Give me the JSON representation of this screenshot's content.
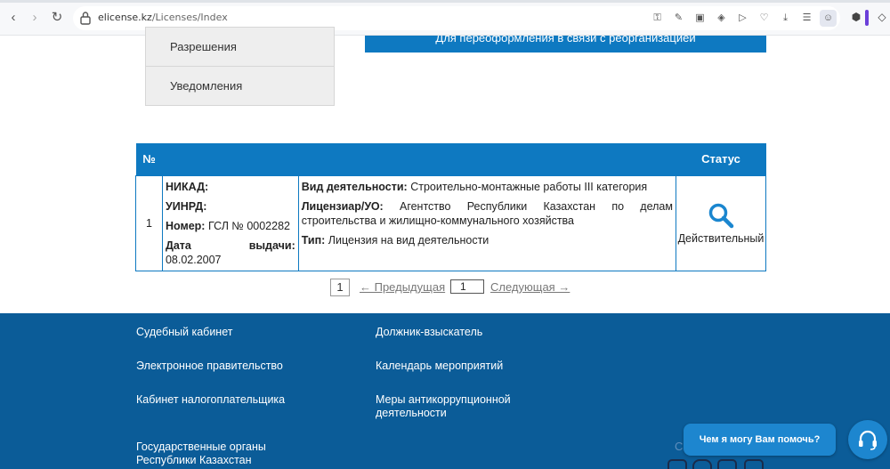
{
  "browser": {
    "url_domain": "elicense.kz",
    "url_path": "/Licenses/Index",
    "icons": [
      "key-icon",
      "edit-icon",
      "camera-icon",
      "shield-icon",
      "send-icon",
      "heart-icon",
      "download-icon",
      "playlist-icon",
      "profile-icon"
    ]
  },
  "sidebar": {
    "items": [
      {
        "label": "Разрешения"
      },
      {
        "label": "Уведомления"
      }
    ]
  },
  "reissue_button": {
    "label": "Для переоформления в связи с реорганизацией"
  },
  "table": {
    "headers": {
      "num": "№",
      "status": "Статус"
    },
    "row": {
      "num": "1",
      "nikad_label": "НИКАД:",
      "uinrd_label": "УИНРД:",
      "number_label": "Номер:",
      "number_value": "ГСЛ № 0002282",
      "date_label": "Дата выдачи:",
      "date_value": "08.02.2007",
      "activity_label": "Вид деятельности:",
      "activity_value": "Строительно-монтажные работы III категория",
      "licensor_label": "Лицензиар/УО:",
      "licensor_value_line1": "Агентство Республики Казахстан по делам",
      "licensor_value_line2": "строительства и жилищно-коммунального хозяйства",
      "type_label": "Тип:",
      "type_value": "Лицензия на вид деятельности",
      "status": "Действительный"
    }
  },
  "pagination": {
    "current_page": "1",
    "prev_label": "← Предыдущая",
    "page_input": "1",
    "next_label": "Следующая →"
  },
  "footer": {
    "links": [
      "Судебный кабинет",
      "Электронное правительство",
      "Кабинет налогоплательщика",
      "Государственные органы Республики Казахстан",
      "Должник-взыскатель",
      "Календарь мероприятий",
      "Меры антикоррупционной деятельности"
    ],
    "chat_label": "Чем я могу Вам помочь?",
    "social_partial": "С"
  },
  "colors": {
    "primary_blue": "#0e79c1",
    "footer_blue": "#0b5c98",
    "chat_blue": "#1d86cf"
  }
}
